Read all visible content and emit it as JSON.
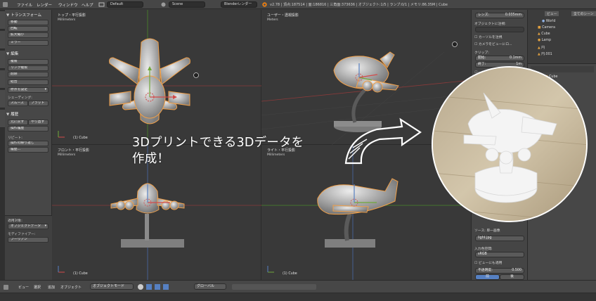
{
  "topbar": {
    "menus": [
      "ファイル",
      "レンダー",
      "ウィンドウ",
      "ヘルプ"
    ],
    "layout_field": "Default",
    "scene_field": "Scene",
    "engine_field": "Blenderレンダー",
    "stats": "v2.78 | 頂点:187514 | 面:186816 | 三角面:373636 | オブジェクト:1/5 | ランプ:0/1 | メモリ:86.35M | Cube"
  },
  "shelf": {
    "transform_header": "トランスフォーム",
    "transform_buttons": [
      "移動",
      "回転",
      "拡大縮小",
      "ミラー"
    ],
    "edit_header": "編集",
    "edit_buttons": [
      "複製",
      "リンク複製",
      "削除",
      "結合"
    ],
    "origin_select": "原点を設定",
    "shading_label": "シェーディング:",
    "shading_buttons": [
      "スムーズ",
      "フラット"
    ],
    "history_header": "履歴",
    "history_buttons": [
      "元に戻す",
      "やり直す",
      "操作履歴"
    ],
    "repeat_label": "リピート:",
    "repeat_buttons": [
      "操作の繰り返し",
      "履歴..."
    ],
    "bottom": {
      "label1": "適用対象:",
      "apply_select": "オブジェクトデータ",
      "label2": "モディファイアー:",
      "modifier_button": "ブーリアン"
    }
  },
  "viewports": {
    "top_left": {
      "title": "トップ・平行投影",
      "units": "Millimeters",
      "object": "(1) Cube"
    },
    "top_right": {
      "title": "ユーザー・透視投影",
      "units": "Meters",
      "object": ""
    },
    "bottom_left": {
      "title": "フロント・平行投影",
      "units": "Millimeters",
      "object": "(1) Cube"
    },
    "bottom_right": {
      "title": "ライト・平行投影",
      "units": "Millimeters",
      "object": "(1) Cube"
    }
  },
  "overlay": {
    "line1": "3Dプリントできる3Dデータを",
    "line2": "作成！"
  },
  "npanel": {
    "lens_label": "レンズ:",
    "lens_value": "0.035mm",
    "lock_label": "オブジェクトに注視:",
    "cursor_check": "カーソルを注視",
    "camera_check": "カメラをビューにロ...",
    "clip_label": "クリップ:",
    "clip_start_label": "開始:",
    "clip_start_value": "0.1mm",
    "clip_end_label": "終了:",
    "clip_end_value": "1m",
    "local_camera": "ローカルカメラ",
    "source_label": "ソース:",
    "source_value": "単一画像",
    "image_file": "light.jpg",
    "color_space_label": "入力色空間:",
    "color_space_value": "sRGB",
    "view_as_render": "ビューにも適用",
    "opacity_label": "不透明度:",
    "opacity_value": "0.500",
    "front_back": [
      "前",
      "後"
    ]
  },
  "outliner": {
    "tabs": [
      "ビュー",
      "全てのシーン"
    ],
    "items": [
      "World",
      "Camera",
      "Cube",
      "Lamp",
      "円",
      "円.001"
    ]
  },
  "props": {
    "breadcrumb": "Cube"
  },
  "bottombar": {
    "items": [
      "ビュー",
      "選択",
      "追加",
      "オブジェクト"
    ],
    "mode_select": "オブジェクトモード",
    "orientation_select": "グローバル"
  },
  "colors": {
    "accent_blue": "#5680c2",
    "object_outline": "#f0a04a",
    "axis_red": "#b84a4a",
    "axis_green": "#6fa83a"
  }
}
